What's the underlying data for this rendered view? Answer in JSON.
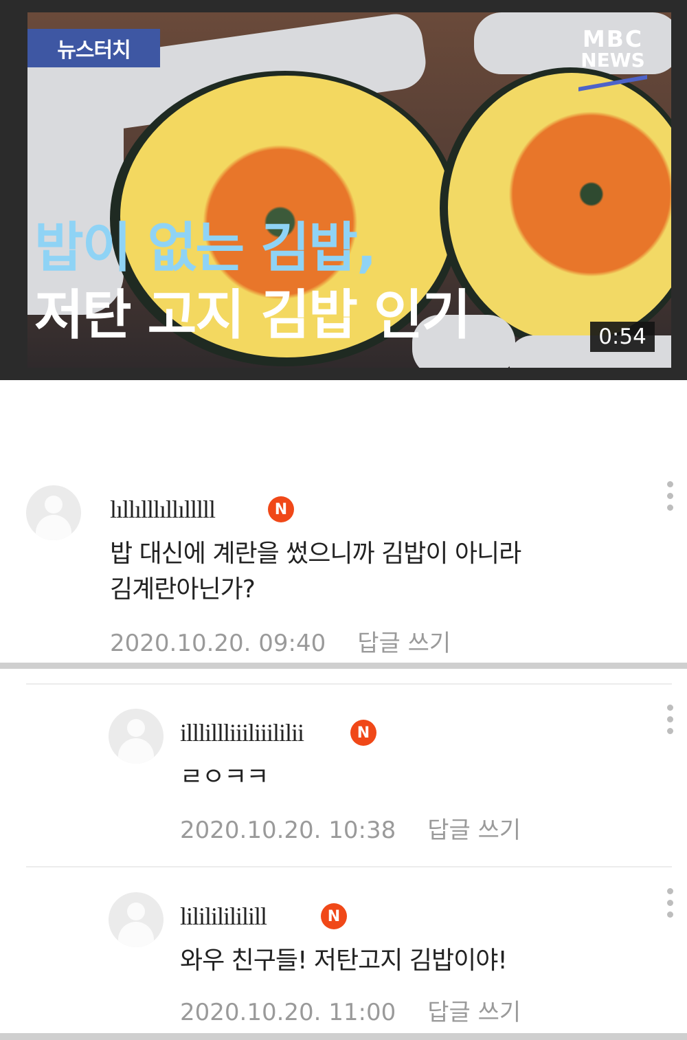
{
  "video": {
    "tag": "뉴스터치",
    "logo_top": "MBC",
    "logo_bottom": "NEWS",
    "headline_line1": "밥이 없는 김밥,",
    "headline_line2": "저탄 고지 김밥 인기",
    "duration": "0:54"
  },
  "comments": [
    {
      "username": "lıllılllıllılllll",
      "badge": "N",
      "text_line1": "밥 대신에 계란을 썼으니까 김밥이 아니라",
      "text_line2": "김계란아닌가?",
      "date": "2020.10.20. 09:40",
      "reply_label": "답글 쓰기"
    },
    {
      "username": "illlillliiiliiililii",
      "badge": "N",
      "text_line1": "ㄹㅇㅋㅋ",
      "date": "2020.10.20. 10:38",
      "reply_label": "답글 쓰기"
    },
    {
      "username": "lilililililill",
      "badge": "N",
      "text_line1": "와우 친구들! 저탄고지 김밥이야!",
      "date": "2020.10.20. 11:00",
      "reply_label": "답글 쓰기"
    }
  ],
  "icons": {
    "more": "kebab-menu-icon",
    "avatar": "default-user-avatar-icon"
  },
  "colors": {
    "badge": "#f04818",
    "tag_bg": "#3e57a3",
    "headline_blue": "#8fd3f5",
    "meta_gray": "#9a9a9a"
  }
}
